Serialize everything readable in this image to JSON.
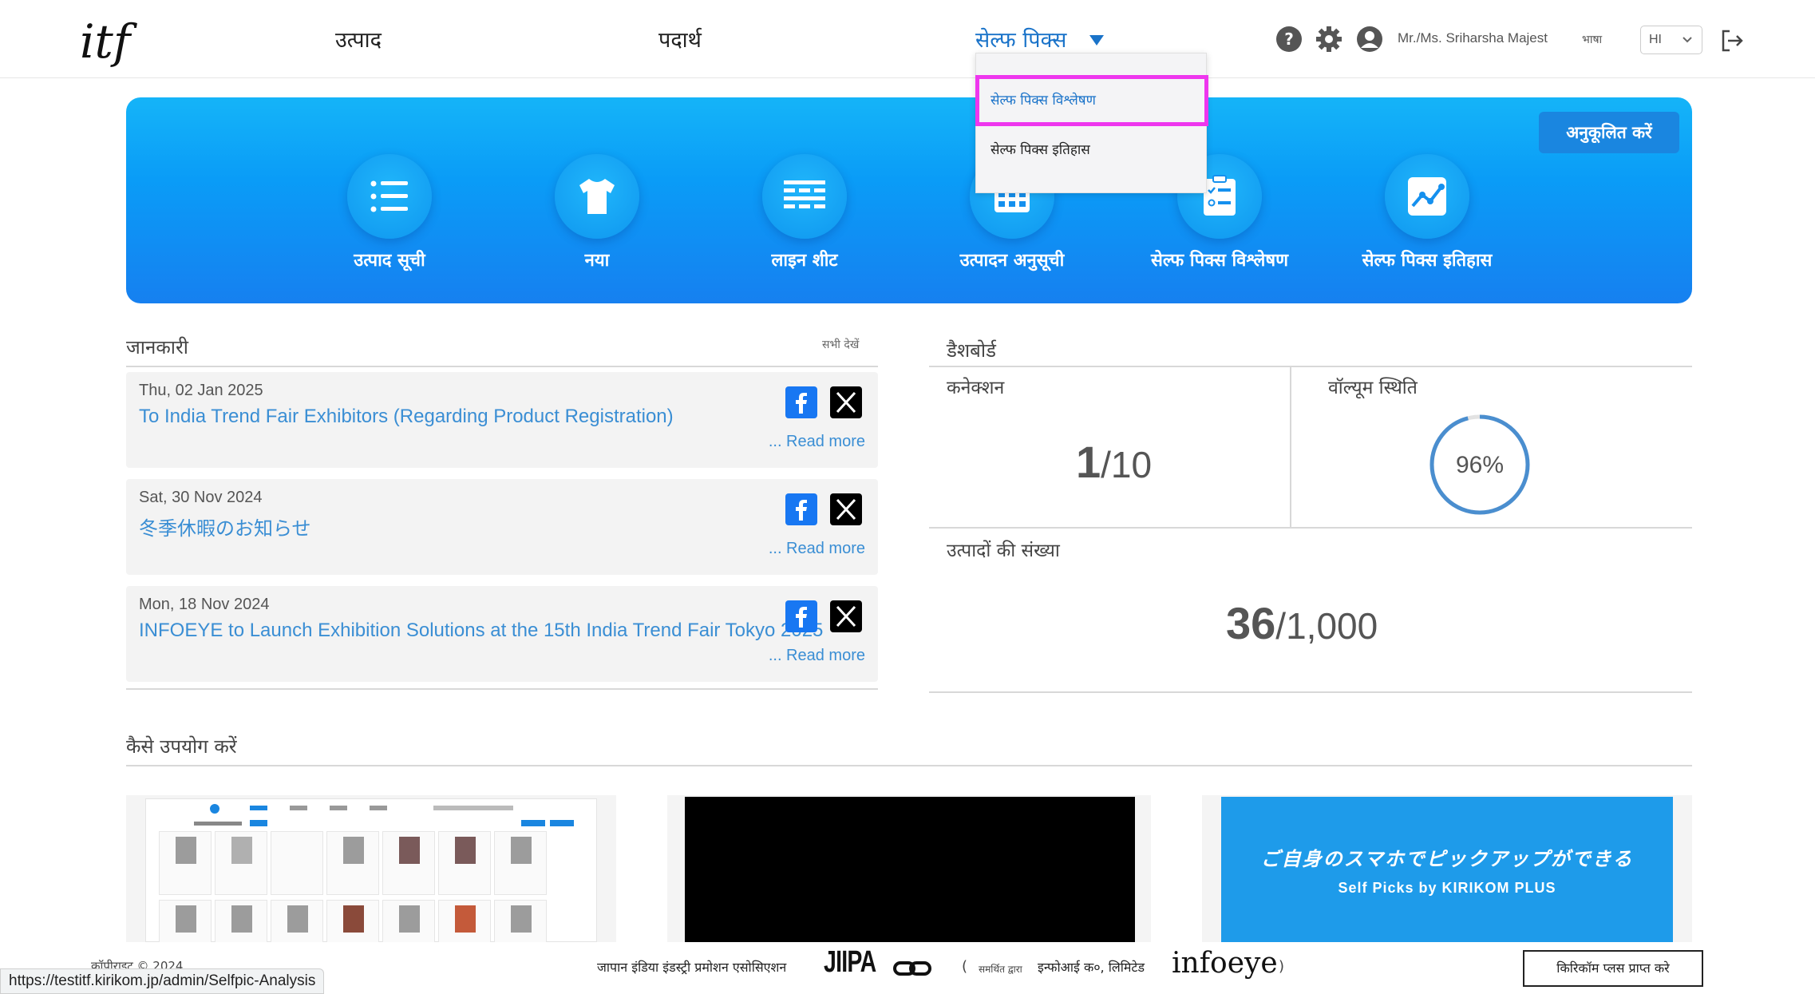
{
  "header": {
    "logo": "itf",
    "nav": {
      "products": "उत्पाद",
      "materials": "पदार्थ",
      "selfpics": "सेल्फ पिक्स"
    },
    "user_name": "Mr./Ms. Sriharsha Majest",
    "language_label": "भाषा",
    "language_value": "HI",
    "icons": [
      "help-icon",
      "gear-icon",
      "user-icon",
      "logout-icon"
    ]
  },
  "dropdown": {
    "items": [
      {
        "label": "सेल्फ पिक्स विश्लेषण"
      },
      {
        "label": "सेल्फ पिक्स इतिहास"
      }
    ],
    "highlight_color": "#ee36ee"
  },
  "banner": {
    "customize_label": "अनुकूलित करें",
    "items": [
      {
        "label": "उत्पाद सूची",
        "icon": "list-icon"
      },
      {
        "label": "नया",
        "icon": "tshirt-icon"
      },
      {
        "label": "लाइन शीट",
        "icon": "line-sheet-icon"
      },
      {
        "label": "उत्पादन अनुसूची",
        "icon": "calendar-icon"
      },
      {
        "label": "सेल्फ पिक्स विश्लेषण",
        "icon": "checklist-icon"
      },
      {
        "label": "सेल्फ पिक्स इतिहास",
        "icon": "chart-icon"
      }
    ],
    "accent": "#0a9cf7"
  },
  "info": {
    "title": "जानकारी",
    "see_all": "सभी देखें",
    "news": [
      {
        "date": "Thu, 02 Jan 2025",
        "title": "To India Trend Fair Exhibitors (Regarding Product Registration)",
        "read_more": "... Read more"
      },
      {
        "date": "Sat, 30 Nov 2024",
        "title": "冬季休暇のお知らせ",
        "read_more": "... Read more"
      },
      {
        "date": "Mon, 18 Nov 2024",
        "title": "INFOEYE to Launch Exhibition Solutions at the 15th India Trend Fair Tokyo 2025",
        "read_more": "... Read more"
      }
    ]
  },
  "dashboard": {
    "title": "डैशबोर्ड",
    "connections_label": "कनेक्शन",
    "connections_value": "1",
    "connections_max": "/10",
    "volume_label": "वॉल्यूम स्थिति",
    "volume_text": "96%",
    "volume_fraction": 0.96,
    "products_label": "उत्पादों की संख्या",
    "products_value": "36",
    "products_max": "/1,000"
  },
  "how_to": {
    "title": "कैसे उपयोग करें",
    "promo_jp": "ご自身のスマホでピックアップができる",
    "promo_en": "Self Picks by KIRIKOM PLUS"
  },
  "footer": {
    "copyright": "कॉपीराइट © 2024",
    "jiipa_text": "जापान इंडिया इंडस्ट्री प्रमोशन एसोसिएशन",
    "jiipa_logo": "JIIPA",
    "paren_open": "(",
    "supported_by": "समर्थित द्वारा",
    "infoeye_co": "इन्फोआई क०, लिमिटेड",
    "infoeye_logo": "infoeye",
    "paren_close": ")",
    "kirikom_button": "किरिकॉम प्लस प्राप्त करे"
  },
  "status_bar": {
    "url": "https://testitf.kirikom.jp/admin/Selfpic-Analysis"
  }
}
